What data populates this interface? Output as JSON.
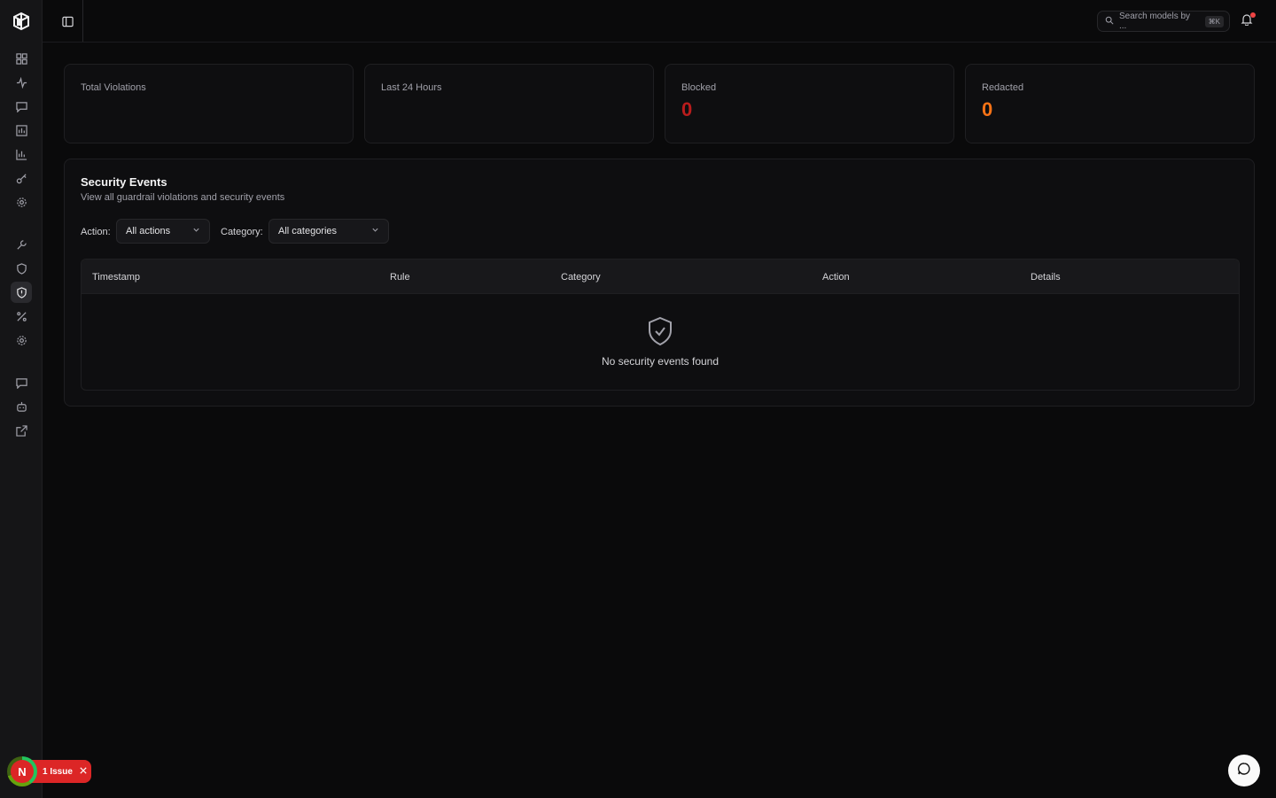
{
  "header": {
    "search_placeholder": "Search models by ...",
    "search_shortcut": "⌘K"
  },
  "sidebar": {
    "items": [
      {
        "icon": "dashboard-icon"
      },
      {
        "icon": "activity-icon"
      },
      {
        "icon": "chat-icon"
      },
      {
        "icon": "bar-chart-icon"
      },
      {
        "icon": "analytics-icon"
      },
      {
        "icon": "key-icon"
      },
      {
        "icon": "settings-icon"
      },
      {
        "icon": "wrench-icon"
      },
      {
        "icon": "shield-icon"
      },
      {
        "icon": "shield-alert-icon",
        "active": true
      },
      {
        "icon": "percent-icon"
      },
      {
        "icon": "cog-icon"
      },
      {
        "icon": "message-icon"
      },
      {
        "icon": "bot-icon"
      },
      {
        "icon": "external-link-icon"
      }
    ]
  },
  "stats": {
    "total_violations": {
      "label": "Total Violations",
      "value": ""
    },
    "last_24_hours": {
      "label": "Last 24 Hours",
      "value": ""
    },
    "blocked": {
      "label": "Blocked",
      "value": "0",
      "color": "#b91c1c"
    },
    "redacted": {
      "label": "Redacted",
      "value": "0",
      "color": "#f97316"
    }
  },
  "events": {
    "title": "Security Events",
    "subtitle": "View all guardrail violations and security events",
    "action_filter_label": "Action:",
    "action_filter_value": "All actions",
    "category_filter_label": "Category:",
    "category_filter_value": "All categories",
    "columns": [
      "Timestamp",
      "Rule",
      "Category",
      "Action",
      "Details"
    ],
    "empty_message": "No security events found"
  },
  "issue_badge": {
    "avatar_letter": "N",
    "label": "1 Issue"
  },
  "colors": {
    "background": "#0a0a0b",
    "sidebar": "#151517",
    "issue_red": "#dc2626"
  }
}
